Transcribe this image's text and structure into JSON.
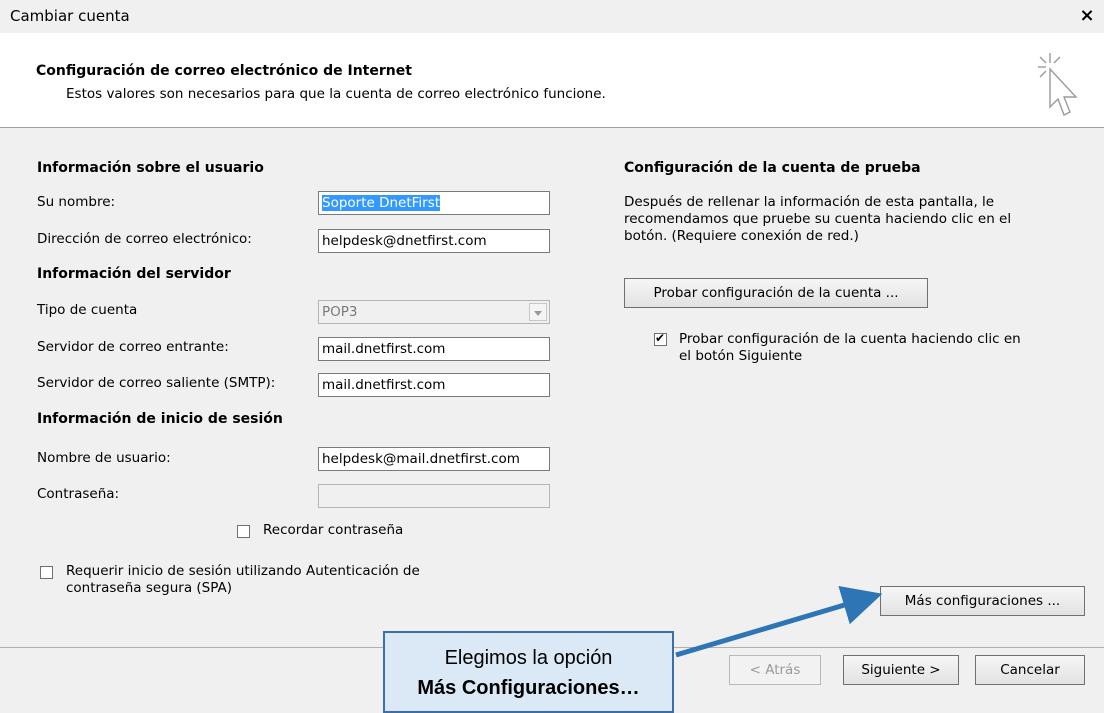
{
  "window": {
    "title": "Cambiar cuenta",
    "close": "×"
  },
  "header": {
    "title": "Configuración de correo electrónico de Internet",
    "subtitle": "Estos valores son necesarios para que la cuenta de correo electrónico funcione."
  },
  "user_section": {
    "heading": "Información sobre el usuario",
    "name_label": "Su nombre:",
    "name_value": "Soporte DnetFirst",
    "email_label": "Dirección de correo electrónico:",
    "email_value": "helpdesk@dnetfirst.com"
  },
  "server_section": {
    "heading": "Información del servidor",
    "type_label": "Tipo de cuenta",
    "type_value": "POP3",
    "incoming_label": "Servidor de correo entrante:",
    "incoming_value": "mail.dnetfirst.com",
    "outgoing_label": "Servidor de correo saliente (SMTP):",
    "outgoing_value": "mail.dnetfirst.com"
  },
  "login_section": {
    "heading": "Información de inicio de sesión",
    "user_label": "Nombre de usuario:",
    "user_value": "helpdesk@mail.dnetfirst.com",
    "password_label": "Contraseña:",
    "password_value": "",
    "remember_label": "Recordar contraseña",
    "remember_checked": false,
    "spa_label_1": "Requerir inicio de sesión utilizando Autenticación de",
    "spa_label_2": "contraseña segura (SPA)",
    "spa_checked": false
  },
  "test_section": {
    "heading": "Configuración de la cuenta de prueba",
    "desc_1": "Después de rellenar la información de esta pantalla, le",
    "desc_2": "recomendamos que pruebe su cuenta haciendo clic en el",
    "desc_3": "botón. (Requiere conexión de red.)",
    "test_button": "Probar configuración de la cuenta ...",
    "auto_test_label_1": "Probar configuración de la cuenta haciendo clic en",
    "auto_test_label_2": "el botón Siguiente",
    "auto_test_checked": true
  },
  "buttons": {
    "more_settings": "Más configuraciones ...",
    "back": "< Atrás",
    "next": "Siguiente >",
    "cancel": "Cancelar"
  },
  "callout": {
    "line1": "Elegimos la opción",
    "line2": "Más Configuraciones…"
  },
  "colors": {
    "selection": "#3399ff",
    "callout_fill": "#dbe8f6",
    "arrow": "#2e75b6"
  },
  "icons": [
    "close-icon",
    "cursor-wizard-icon",
    "dropdown-arrow-icon",
    "checkmark-icon",
    "arrow-annotation-icon"
  ]
}
